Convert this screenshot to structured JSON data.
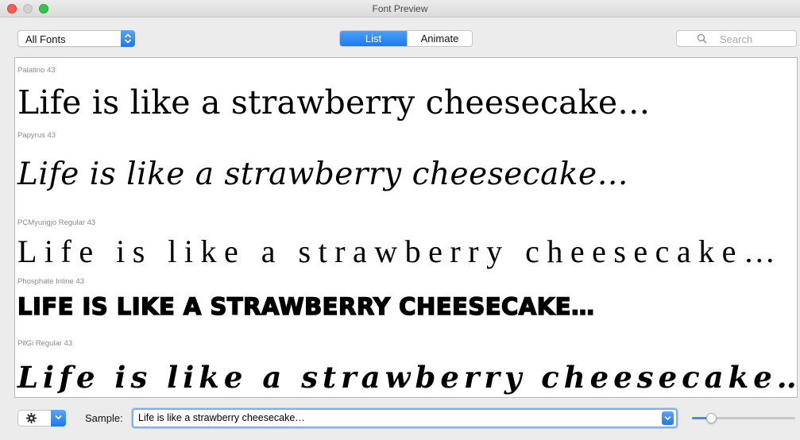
{
  "window": {
    "title": "Font Preview"
  },
  "toolbar": {
    "collection_popup": "All Fonts",
    "view_modes": [
      {
        "label": "List",
        "selected": true
      },
      {
        "label": "Animate",
        "selected": false
      }
    ],
    "search_placeholder": "Search"
  },
  "preview": {
    "fonts": [
      {
        "label": "Palatino 43",
        "sample": "Life is like a strawberry cheesecake…"
      },
      {
        "label": "Papyrus 43",
        "sample": "Life is like a strawberry cheesecake…"
      },
      {
        "label": "PCMyungjo Regular 43",
        "sample": "Life is like a strawberry cheesecake…"
      },
      {
        "label": "Phosphate Inline 43",
        "sample": "Life is like a strawberry cheesecake…"
      },
      {
        "label": "PilGi Regular 43",
        "sample": "Life is like a strawberry cheesecake…"
      }
    ]
  },
  "bottom": {
    "sample_label": "Sample:",
    "sample_value": "Life is like a strawberry cheesecake…",
    "size_slider_fraction": 0.15
  },
  "colors": {
    "accent": "#1a7af0",
    "close": "#fc5b57",
    "minimize": "#d0d0d0",
    "zoom": "#34c84a"
  },
  "icons": {
    "popup_arrow": "updown-chevron-icon",
    "search": "magnifier-icon",
    "gear": "gear-icon",
    "combo_arrow": "chevron-down-icon"
  }
}
